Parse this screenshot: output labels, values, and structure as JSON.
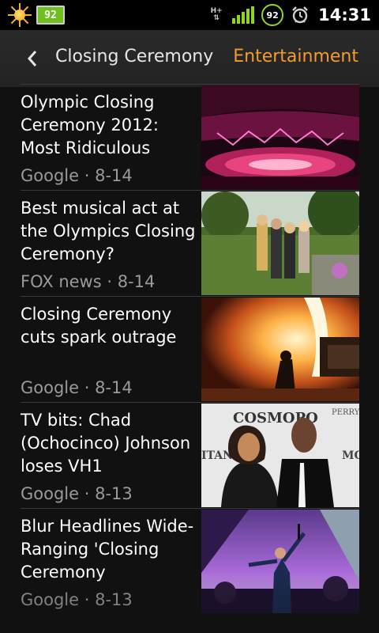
{
  "status_bar": {
    "battery_badge": "92",
    "network_label": "H+",
    "battery_percent": "92",
    "time": "14:31",
    "icons": [
      "weather-sun-icon",
      "battery-badge-icon",
      "network-hplus-icon",
      "signal-icon",
      "battery-circle-icon",
      "alarm-icon"
    ],
    "accent": "#8fd61f"
  },
  "header": {
    "back_icon": "chevron-left-icon",
    "title": "Closing Ceremony",
    "section": "Entertainment",
    "section_color": "#f29b2e"
  },
  "articles": [
    {
      "title": "Olympic Closing Ceremony 2012: Most Ridiculous",
      "source": "Google",
      "date": "8-14",
      "meta": "Google · 8-14",
      "thumbnail": "stadium-lights-image"
    },
    {
      "title": "Best musical act at the Olympics Closing Ceremony?",
      "source": "FOX news",
      "date": "8-14",
      "meta": "FOX news · 8-14",
      "thumbnail": "group-in-garden-image"
    },
    {
      "title": "Closing Ceremony cuts spark outrage",
      "source": "Google",
      "date": "8-14",
      "meta": "Google · 8-14",
      "thumbnail": "pyrotechnics-stage-image"
    },
    {
      "title": "TV bits: Chad (Ochocinco) Johnson loses VH1",
      "source": "Google",
      "date": "8-13",
      "meta": "Google · 8-13",
      "thumbnail": "couple-red-carpet-image"
    },
    {
      "title": "Blur Headlines Wide-Ranging 'Closing Ceremony",
      "source": "Google",
      "date": "8-13",
      "meta": "Google · 8-13",
      "thumbnail": "concert-performer-image"
    }
  ]
}
